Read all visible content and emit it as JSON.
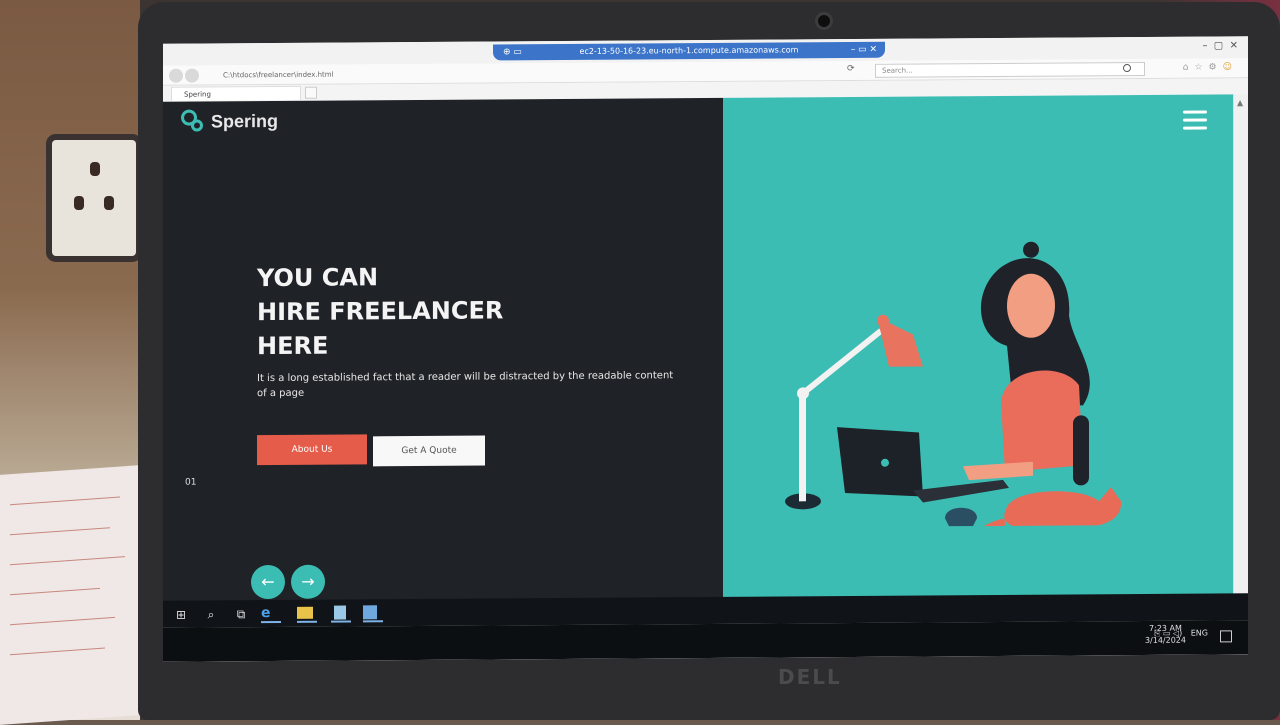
{
  "browser": {
    "remote_title": "ec2-13-50-16-23.eu-north-1.compute.amazonaws.com",
    "url": "C:\\htdocs\\freelancer\\index.html",
    "search_placeholder": "Search...",
    "tab_title": "Spering"
  },
  "site": {
    "logo_text": "Spering",
    "hero_lines": [
      "YOU CAN",
      "HIRE FREELANCER",
      "HERE"
    ],
    "hero_text": "It is a long established fact that a reader will be distracted by the readable content of a page",
    "about_button": "About Us",
    "quote_button": "Get A Quote",
    "slide_number": "01",
    "prev_arrow": "←",
    "next_arrow": "→"
  },
  "taskbar": {
    "language": "ENG",
    "time": "7:23 AM",
    "date": "3/14/2024"
  },
  "device": {
    "brand": "DELL"
  },
  "colors": {
    "accent": "#3cbdb3",
    "primary_button": "#e65c4a",
    "dark_bg": "#1f2227"
  }
}
